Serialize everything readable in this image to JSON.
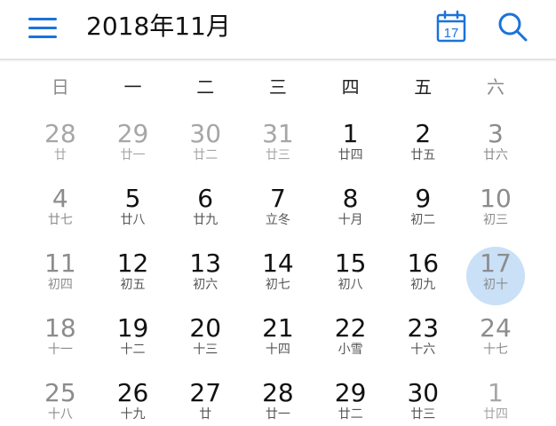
{
  "header": {
    "title": "2018年11月",
    "today_icon_day": "17",
    "accent_color": "#1a73d9"
  },
  "weekdays": [
    "日",
    "一",
    "二",
    "三",
    "四",
    "五",
    "六"
  ],
  "calendar": {
    "today_highlight_color": "#c9e0f7",
    "weeks": [
      [
        {
          "num": "28",
          "lunar": "廿",
          "other": true
        },
        {
          "num": "29",
          "lunar": "廿一",
          "other": true
        },
        {
          "num": "30",
          "lunar": "廿二",
          "other": true
        },
        {
          "num": "31",
          "lunar": "廿三",
          "other": true
        },
        {
          "num": "1",
          "lunar": "廿四",
          "other": false
        },
        {
          "num": "2",
          "lunar": "廿五",
          "other": false
        },
        {
          "num": "3",
          "lunar": "廿六",
          "other": false
        }
      ],
      [
        {
          "num": "4",
          "lunar": "廿七",
          "other": false
        },
        {
          "num": "5",
          "lunar": "廿八",
          "other": false
        },
        {
          "num": "6",
          "lunar": "廿九",
          "other": false
        },
        {
          "num": "7",
          "lunar": "立冬",
          "other": false
        },
        {
          "num": "8",
          "lunar": "十月",
          "other": false
        },
        {
          "num": "9",
          "lunar": "初二",
          "other": false
        },
        {
          "num": "10",
          "lunar": "初三",
          "other": false
        }
      ],
      [
        {
          "num": "11",
          "lunar": "初四",
          "other": false
        },
        {
          "num": "12",
          "lunar": "初五",
          "other": false
        },
        {
          "num": "13",
          "lunar": "初六",
          "other": false
        },
        {
          "num": "14",
          "lunar": "初七",
          "other": false
        },
        {
          "num": "15",
          "lunar": "初八",
          "other": false
        },
        {
          "num": "16",
          "lunar": "初九",
          "other": false
        },
        {
          "num": "17",
          "lunar": "初十",
          "other": false,
          "today": true
        }
      ],
      [
        {
          "num": "18",
          "lunar": "十一",
          "other": false
        },
        {
          "num": "19",
          "lunar": "十二",
          "other": false
        },
        {
          "num": "20",
          "lunar": "十三",
          "other": false
        },
        {
          "num": "21",
          "lunar": "十四",
          "other": false
        },
        {
          "num": "22",
          "lunar": "小雪",
          "other": false
        },
        {
          "num": "23",
          "lunar": "十六",
          "other": false
        },
        {
          "num": "24",
          "lunar": "十七",
          "other": false
        }
      ],
      [
        {
          "num": "25",
          "lunar": "十八",
          "other": false
        },
        {
          "num": "26",
          "lunar": "十九",
          "other": false
        },
        {
          "num": "27",
          "lunar": "廿",
          "other": false
        },
        {
          "num": "28",
          "lunar": "廿一",
          "other": false
        },
        {
          "num": "29",
          "lunar": "廿二",
          "other": false
        },
        {
          "num": "30",
          "lunar": "廿三",
          "other": false
        },
        {
          "num": "1",
          "lunar": "廿四",
          "other": true
        }
      ]
    ]
  }
}
